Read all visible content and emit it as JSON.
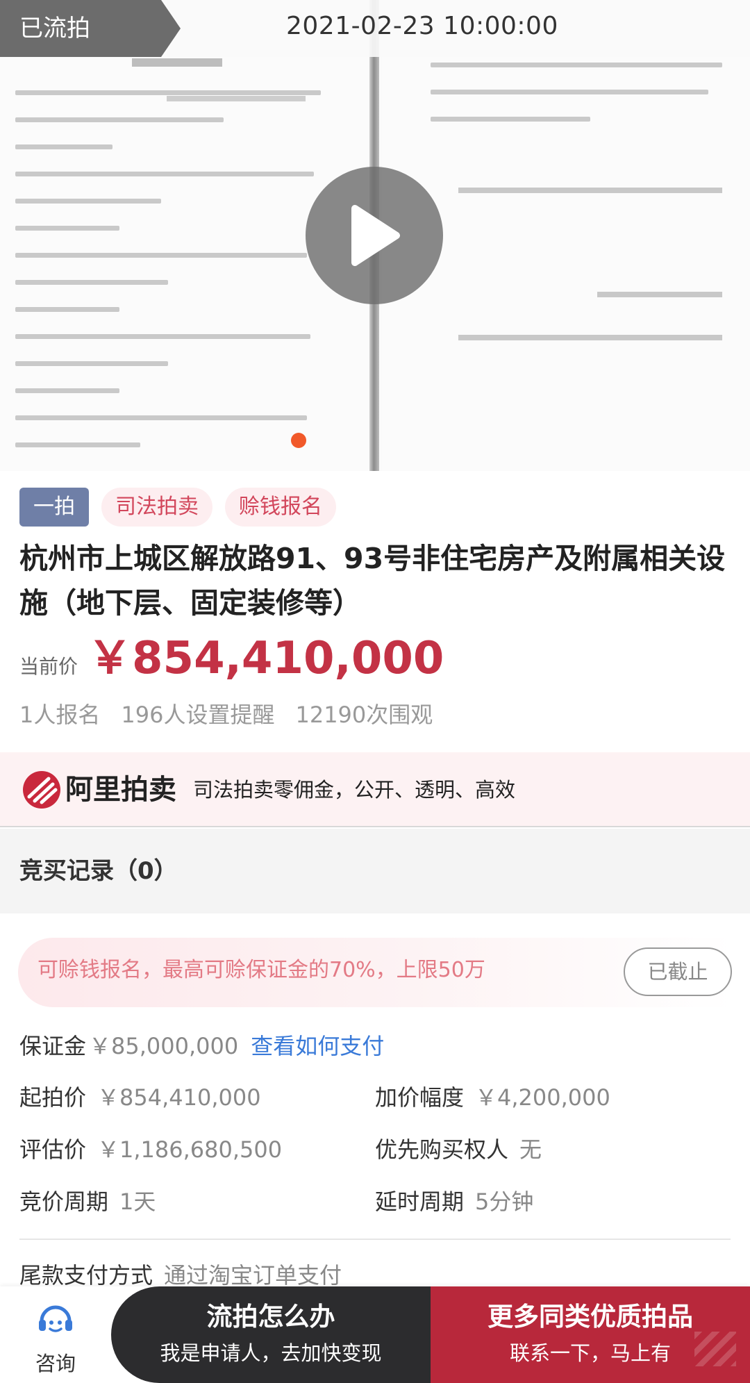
{
  "hero": {
    "status": "已流拍",
    "time": "2021-02-23 10:00:00"
  },
  "tags": [
    "一拍",
    "司法拍卖",
    "赊钱报名"
  ],
  "title": "杭州市上城区解放路91、93号非住宅房产及附属相关设施（地下层、固定装修等）",
  "price": {
    "label": "当前价",
    "value": "￥854,410,000"
  },
  "stats": [
    "1人报名",
    "196人设置提醒",
    "12190次围观"
  ],
  "banner": {
    "logo_text": "阿里拍卖",
    "slogan": "司法拍卖零佣金，公开、透明、高效"
  },
  "records": {
    "title": "竞买记录（0）"
  },
  "notice": {
    "text": "可赊钱报名，最高可赊保证金的70%，上限50万",
    "button": "已截止"
  },
  "info": {
    "deposit_label": "保证金",
    "deposit_value": "￥85,000,000",
    "deposit_link": "查看如何支付",
    "start_label": "起拍价",
    "start_value": "￥854,410,000",
    "increment_label": "加价幅度",
    "increment_value": "￥4,200,000",
    "appraisal_label": "评估价",
    "appraisal_value": "￥1,186,680,500",
    "priority_label": "优先购买权人",
    "priority_value": "无",
    "cycle_label": "竞价周期",
    "cycle_value": "1天",
    "delay_label": "延时周期",
    "delay_value": "5分钟",
    "payment_label": "尾款支付方式",
    "payment_value": "通过淘宝订单支付"
  },
  "bottom": {
    "consult_label": "咨询",
    "dark_main": "流拍怎么办",
    "dark_sub": "我是申请人，去加快变现",
    "red_main": "更多同类优质拍品",
    "red_sub": "联系一下，马上有"
  },
  "colors": {
    "accent_red": "#c33245",
    "button_red": "#b8283b",
    "link_blue": "#3a7ad8",
    "tag_blue": "#6f7fa7"
  }
}
